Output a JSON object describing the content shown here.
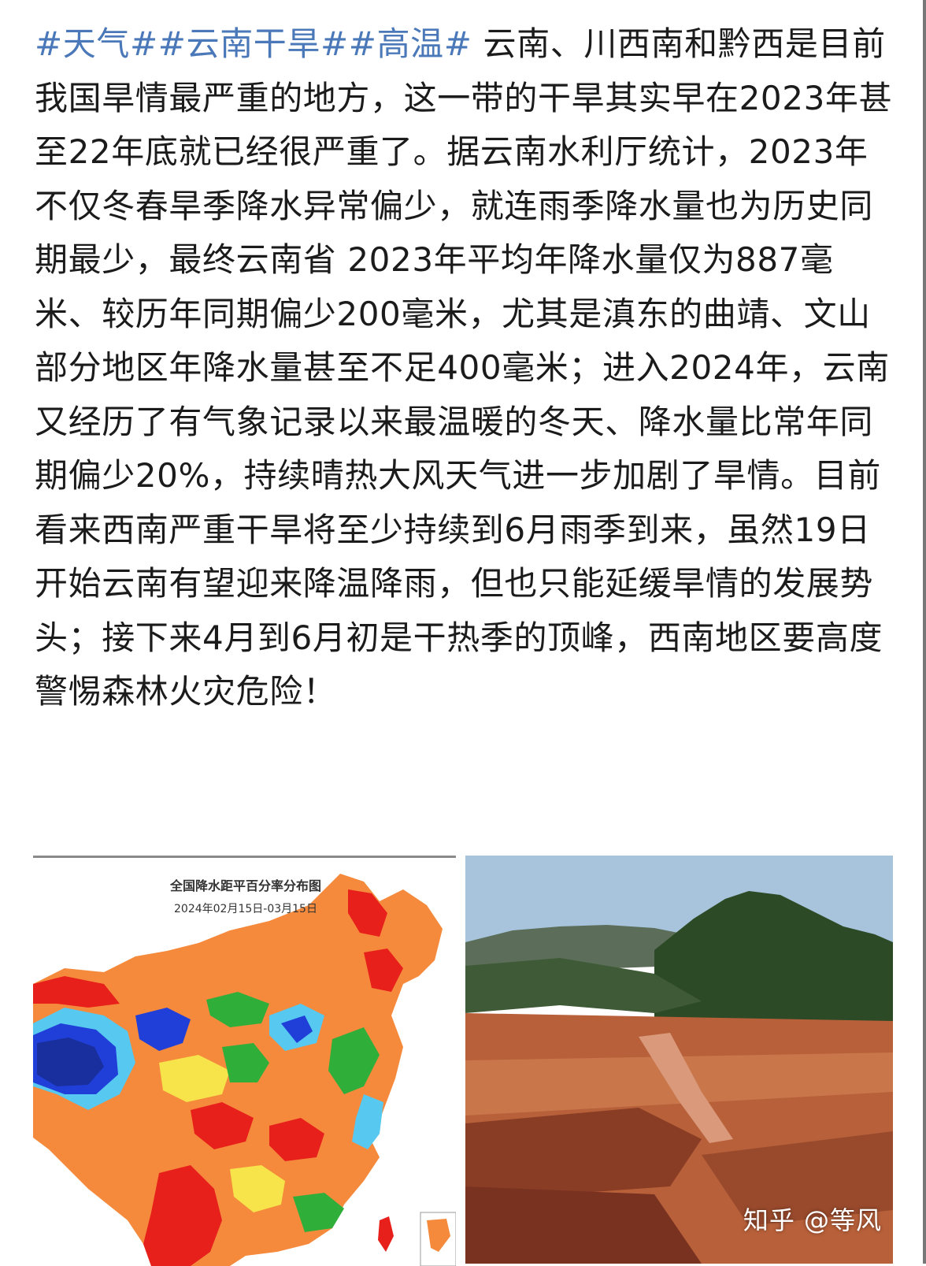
{
  "post": {
    "tags": [
      "#天气#",
      "#云南干旱#",
      "#高温#"
    ],
    "text": "云南、川西南和黔西是目前我国旱情最严重的地方，这一带的干旱其实早在2023年甚至22年底就已经很严重了。据云南水利厅统计，2023年不仅冬春旱季降水异常偏少，就连雨季降水量也为历史同期最少，最终云南省 2023年平均年降水量仅为887毫米、较历年同期偏少200毫米，尤其是滇东的曲靖、文山部分地区年降水量甚至不足400毫米；进入2024年，云南又经历了有气象记录以来最温暖的冬天、降水量比常年同期偏少20%，持续晴热大风天气进一步加剧了旱情。目前看来西南严重干旱将至少持续到6月雨季到来，虽然19日开始云南有望迎来降温降雨，但也只能延缓旱情的发展势头；接下来4月到6月初是干热季的顶峰，西南地区要高度警惕森林火灾危险！"
  },
  "map": {
    "title": "全国降水距平百分率分布图",
    "date_range": "2024年02月15日-03月15日",
    "colors": {
      "red": "#e8201c",
      "orange": "#f58a3c",
      "yellow": "#f7e34a",
      "green": "#2fae3a",
      "light_blue": "#57c8f0",
      "blue": "#1f3fd8",
      "dark_blue": "#1a2f9e"
    }
  },
  "photo": {
    "colors": {
      "sky": "#a7c4dc",
      "forest": "#2d4a26",
      "soil": "#b8603a",
      "soil_dark": "#8a3d25"
    }
  },
  "watermark": "知乎 @等风"
}
